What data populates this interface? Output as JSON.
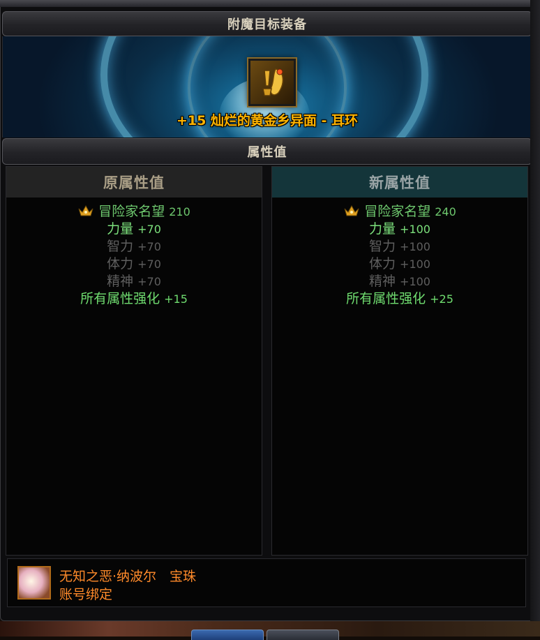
{
  "window": {
    "title": "附魔目标装备",
    "attr_header": "属性值"
  },
  "item": {
    "icon": "earring-icon",
    "name": "+15 灿烂的黄金乡异面 - 耳环",
    "name_color": "#ffb400"
  },
  "original": {
    "header": "原属性值",
    "adventurer_fame_label": "冒险家名望",
    "adventurer_fame_value": "210",
    "stats": [
      {
        "label": "力量",
        "value": "+70",
        "active": true
      },
      {
        "label": "智力",
        "value": "+70",
        "active": false
      },
      {
        "label": "体力",
        "value": "+70",
        "active": false
      },
      {
        "label": "精神",
        "value": "+70",
        "active": false
      }
    ],
    "all_element": {
      "label": "所有属性强化",
      "value": "+15"
    }
  },
  "new": {
    "header": "新属性值",
    "adventurer_fame_label": "冒险家名望",
    "adventurer_fame_value": "240",
    "stats": [
      {
        "label": "力量",
        "value": "+100",
        "active": true
      },
      {
        "label": "智力",
        "value": "+100",
        "active": false
      },
      {
        "label": "体力",
        "value": "+100",
        "active": false
      },
      {
        "label": "精神",
        "value": "+100",
        "active": false
      }
    ],
    "all_element": {
      "label": "所有属性强化",
      "value": "+25"
    }
  },
  "enchant_item": {
    "icon": "orb-icon",
    "name": "无知之恶·纳波尔　宝珠",
    "binding": "账号绑定",
    "color": "#ff8a2a"
  },
  "colors": {
    "active_stat": "#7ce07c",
    "inactive_stat": "#5f5f5f",
    "fame": "#6ec86e",
    "new_header_bg": "#14353a"
  }
}
